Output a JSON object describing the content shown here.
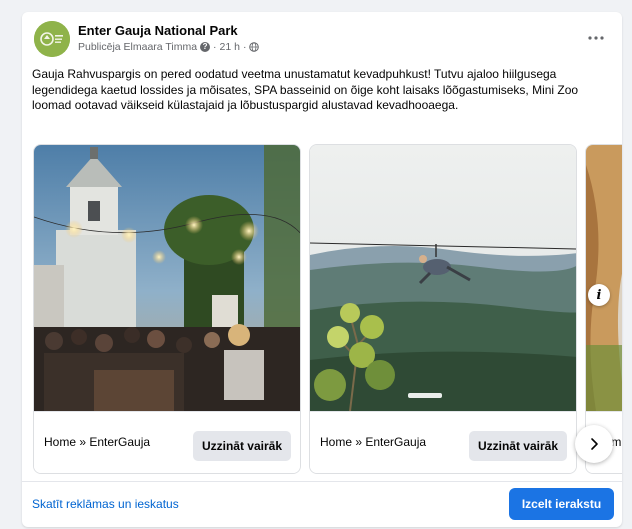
{
  "post": {
    "page_name": "Enter Gauja National Park",
    "publisher": "Publicēja Elmaara Timma",
    "time": "21 h",
    "text": "Gauja Rahvuspargis on pered oodatud veetma unustamatut kevadpuhkust! Tutvu ajaloo hiilgusega legendidega kaetud lossides ja mõisates, SPA basseinid on õige koht laisaks lõõgastumiseks, Mini Zoo loomad ootavad väikseid külastajaid ja lõbustuspargid alustavad kevadhooaega."
  },
  "carousel": {
    "cards": [
      {
        "title": "Home » EnterGauja",
        "button": "Uzzināt vairāk"
      },
      {
        "title": "Home » EnterGauja",
        "button": "Uzzināt vairāk"
      },
      {
        "title": "Hom"
      }
    ]
  },
  "footer": {
    "insights_link": "Skatīt reklāmas un ieskatus",
    "boost_button": "Izcelt ierakstu"
  },
  "icons": {
    "more": "more-horizontal-icon",
    "next": "chevron-right-icon",
    "info": "info-icon",
    "audience": "globe-icon",
    "question": "question-icon"
  },
  "colors": {
    "link": "#0064d1",
    "primary_button": "#1b74e4",
    "secondary_button": "#e4e6eb",
    "avatar_bg": "#8fb34a"
  }
}
